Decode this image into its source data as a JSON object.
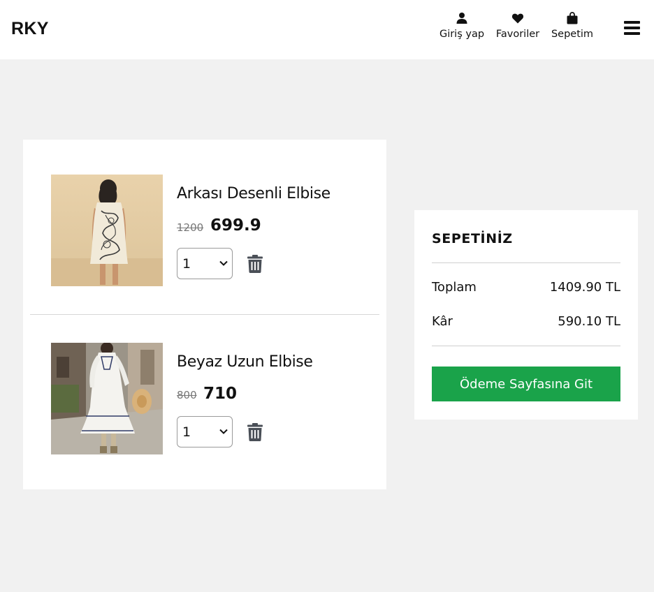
{
  "header": {
    "logo": "RKY",
    "nav": {
      "login_label": "Giriş yap",
      "favorites_label": "Favoriler",
      "cart_label": "Sepetim"
    },
    "icons": {
      "login": "user-icon",
      "favorites": "heart-icon",
      "cart": "shopping-bag-icon",
      "menu": "hamburger-menu-icon"
    }
  },
  "cart": {
    "items": [
      {
        "name": "Arkası Desenli Elbise",
        "old_price": "1200",
        "price": "699.9",
        "quantity": "1",
        "delete_icon": "trash-icon"
      },
      {
        "name": "Beyaz Uzun Elbise",
        "old_price": "800",
        "price": "710",
        "quantity": "1",
        "delete_icon": "trash-icon"
      }
    ]
  },
  "summary": {
    "title": "SEPETİNİZ",
    "total_label": "Toplam",
    "total_value": "1409.90 TL",
    "profit_label": "Kâr",
    "profit_value": "590.10 TL",
    "checkout_label": "Ödeme Sayfasına Git"
  },
  "colors": {
    "page_bg": "#f1f1f1",
    "card_bg": "#ffffff",
    "checkout_button": "#1aa34a",
    "icon_gray": "#4a4f57"
  }
}
